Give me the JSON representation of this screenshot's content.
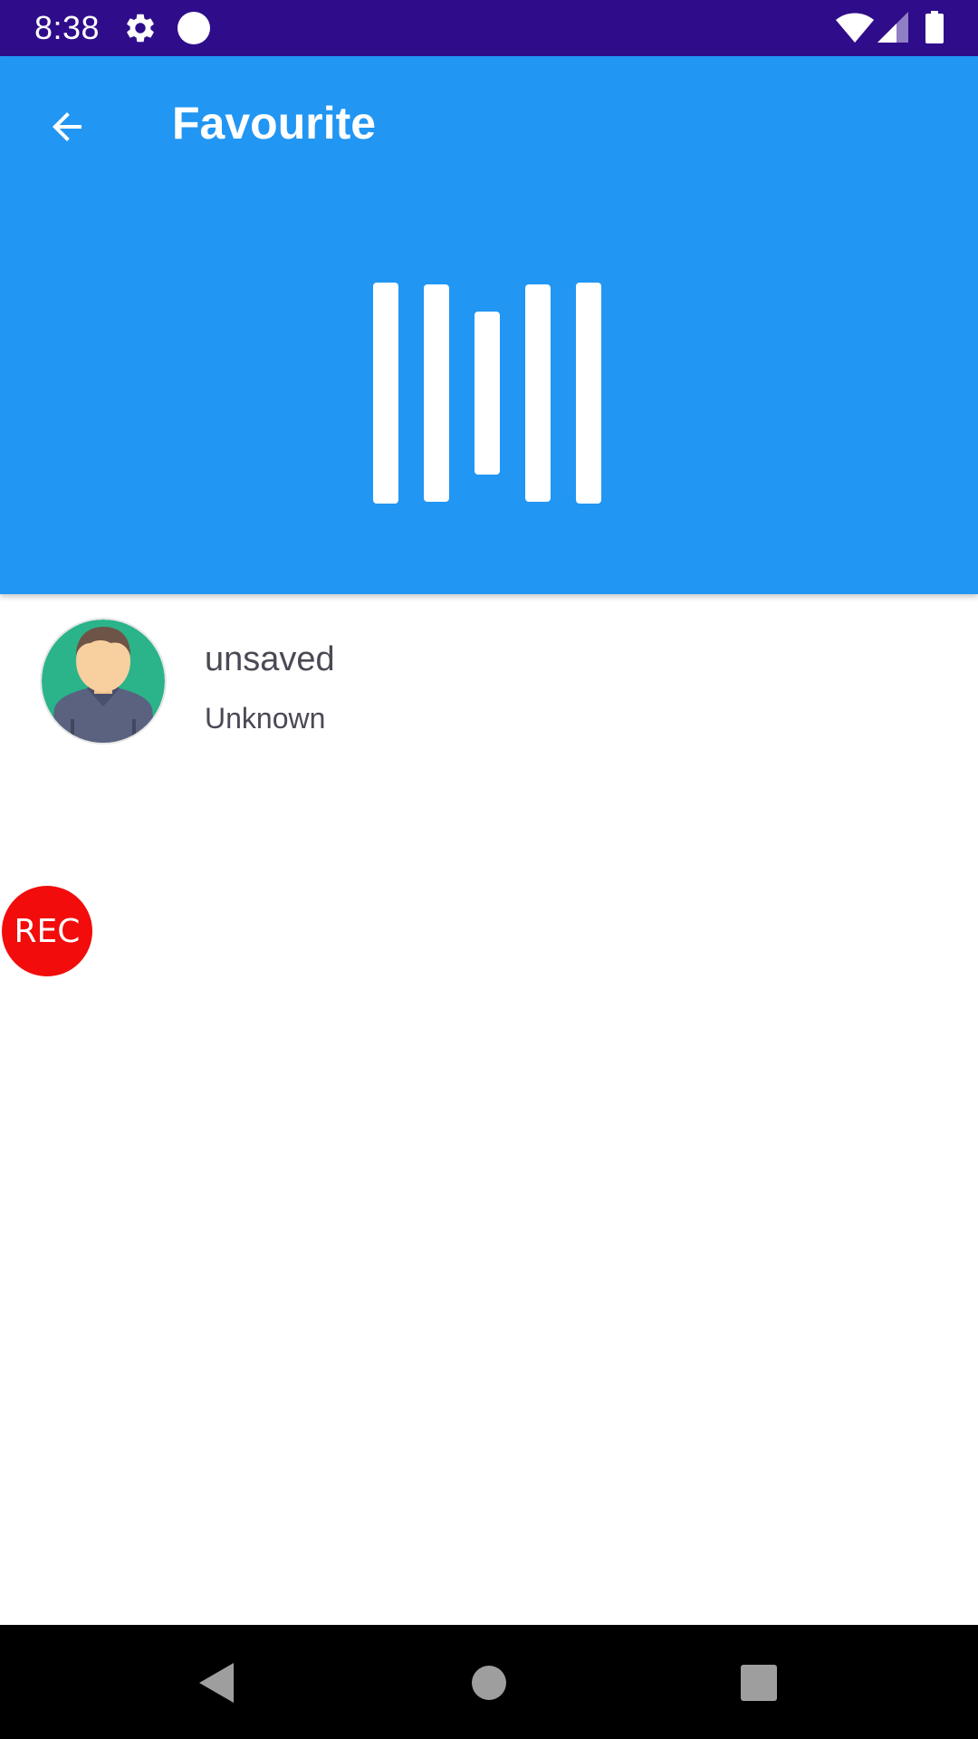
{
  "status_bar": {
    "time": "8:38",
    "icons": [
      "gear-icon",
      "circle-notification-icon",
      "wifi-icon",
      "cell-signal-icon",
      "battery-icon"
    ]
  },
  "header": {
    "title": "Favourite",
    "back_icon": "arrow-back-icon",
    "logo_icon": "bars-logo-icon",
    "background_color": "#2196f3"
  },
  "contacts": [
    {
      "name": "unsaved",
      "type": "Unknown",
      "avatar": "person-avatar-icon"
    }
  ],
  "rec_button": {
    "label": "REC",
    "color": "#f20c0c"
  },
  "nav_bar": {
    "buttons": [
      "back-triangle-icon",
      "home-circle-icon",
      "recents-square-icon"
    ]
  },
  "colors": {
    "status_bar": "#2f0d8a",
    "accent": "#2196f3",
    "text": "#4a4a55"
  }
}
